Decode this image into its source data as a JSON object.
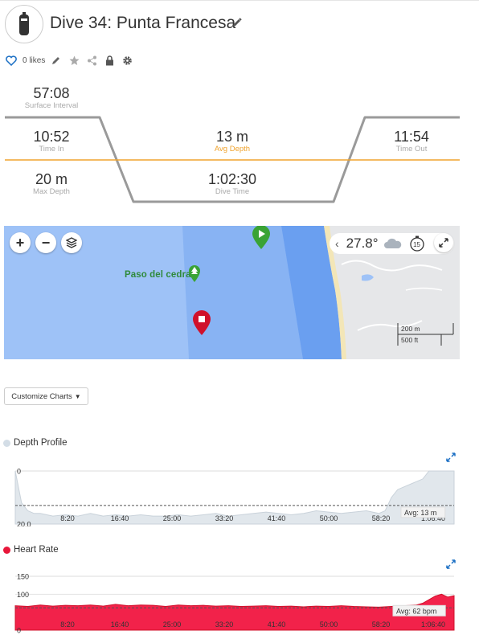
{
  "dive": {
    "title": "Dive 34: Punta Francesa",
    "likes_label": "0 likes"
  },
  "profile": {
    "surface_interval": {
      "value": "57:08",
      "label": "Surface Interval"
    },
    "time_in": {
      "value": "10:52",
      "label": "Time In"
    },
    "avg_depth": {
      "value": "13 m",
      "label": "Avg Depth"
    },
    "time_out": {
      "value": "11:54",
      "label": "Time Out"
    },
    "max_depth": {
      "value": "20 m",
      "label": "Max Depth"
    },
    "dive_time": {
      "value": "1:02:30",
      "label": "Dive Time"
    }
  },
  "map": {
    "temperature": "27.8°",
    "timer": "15",
    "place": "Paso del cedral",
    "scale_metric": "200 m",
    "scale_imperial": "500 ft"
  },
  "toolbar": {
    "customize_label": "Customize Charts"
  },
  "icons": {
    "tank": "tank-icon",
    "edit": "pencil-icon",
    "like": "heart-icon",
    "star": "star-icon",
    "share": "share-icon",
    "lock": "lock-icon",
    "settings": "gear-icon",
    "zoom_in": "plus-icon",
    "zoom_out": "minus-icon",
    "layers": "layers-icon",
    "cloud": "cloud-icon",
    "fullscreen": "expand-icon"
  },
  "colors": {
    "accent_blue": "#1a6fc4",
    "avg_line": "#f0a32e",
    "depth_fill": "#e1e7ec",
    "heart_fill": "#f2224a",
    "start_marker": "#3aa335",
    "end_marker": "#d0112b",
    "water": "#9ec2f7"
  },
  "chart_data": [
    {
      "type": "area",
      "title": "Depth Profile",
      "y_ticks": [
        "0",
        "20.0"
      ],
      "x_ticks": [
        "8:20",
        "16:40",
        "25:00",
        "33:20",
        "41:40",
        "50:00",
        "58:20",
        "1:06:40"
      ],
      "ylim": [
        0,
        20
      ],
      "xlim_minutes": [
        0,
        70
      ],
      "avg_label": "Avg: 13 m",
      "avg": 13,
      "x": [
        0,
        0.5,
        1,
        2,
        3,
        4,
        6,
        8,
        10,
        12,
        14,
        16,
        18,
        20,
        22,
        24,
        26,
        28,
        30,
        32,
        34,
        36,
        38,
        40,
        42,
        44,
        46,
        48,
        50,
        52,
        54,
        56,
        58,
        59,
        60,
        61,
        62,
        63,
        64,
        65,
        66,
        67,
        68,
        69,
        70
      ],
      "values": [
        0,
        6,
        12,
        15,
        16,
        16,
        17,
        16.5,
        17,
        16,
        17,
        16.5,
        17,
        16.5,
        17,
        17,
        16.5,
        17,
        16.5,
        16,
        17,
        16.5,
        16,
        15.5,
        16,
        16.5,
        16,
        15,
        15.5,
        16,
        15.5,
        15,
        16,
        15,
        10,
        7,
        6,
        5,
        4,
        3,
        0,
        0,
        0,
        0,
        0
      ]
    },
    {
      "type": "area",
      "title": "Heart Rate",
      "y_ticks": [
        "150",
        "100",
        "0"
      ],
      "x_ticks": [
        "8:20",
        "16:40",
        "25:00",
        "33:20",
        "41:40",
        "50:00",
        "58:20",
        "1:06:40"
      ],
      "ylim": [
        0,
        150
      ],
      "xlim_minutes": [
        0,
        70
      ],
      "avg_label": "Avg: 62 bpm",
      "avg": 62,
      "x": [
        0,
        2,
        4,
        6,
        8,
        10,
        12,
        14,
        16,
        18,
        20,
        22,
        24,
        26,
        28,
        30,
        32,
        34,
        36,
        38,
        40,
        42,
        44,
        46,
        48,
        50,
        52,
        54,
        56,
        58,
        60,
        62,
        64,
        65,
        66,
        67,
        68,
        69,
        70
      ],
      "values": [
        68,
        66,
        70,
        67,
        69,
        68,
        70,
        67,
        72,
        68,
        70,
        69,
        66,
        70,
        68,
        69,
        67,
        68,
        66,
        67,
        68,
        66,
        67,
        65,
        67,
        66,
        68,
        66,
        65,
        64,
        66,
        68,
        70,
        75,
        85,
        95,
        100,
        92,
        96
      ]
    }
  ]
}
